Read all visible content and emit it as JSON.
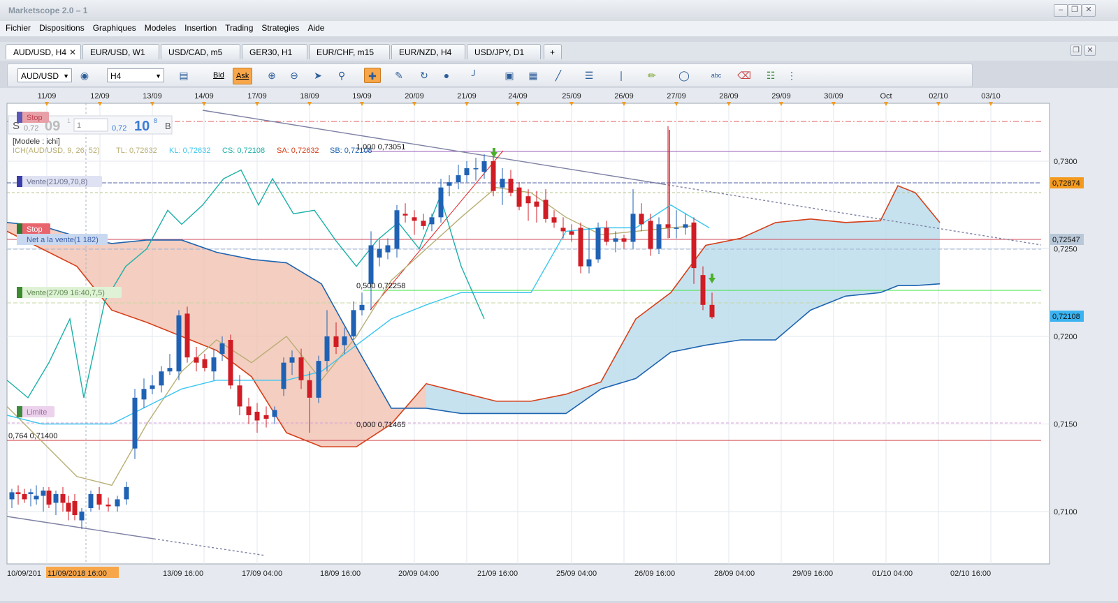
{
  "app": {
    "title": "Marketscope 2.0 – 1",
    "window_buttons": [
      "minimize-icon",
      "restore-icon",
      "close-icon"
    ]
  },
  "menu": [
    "Fichier",
    "Dispositions",
    "Graphiques",
    "Modeles",
    "Insertion",
    "Trading",
    "Strategies",
    "Aide"
  ],
  "tabs": [
    {
      "label": "AUD/USD, H4",
      "active": true,
      "closable": true
    },
    {
      "label": "EUR/USD, W1"
    },
    {
      "label": "USD/CAD, m5"
    },
    {
      "label": "GER30, H1"
    },
    {
      "label": "EUR/CHF, m15"
    },
    {
      "label": "EUR/NZD, H4"
    },
    {
      "label": "USD/JPY, D1"
    }
  ],
  "add_tab_label": "+",
  "toolbar": {
    "instrument": "AUD/USD",
    "timeframe": "H4",
    "bid_label": "Bid",
    "ask_label": "Ask",
    "icons": [
      "chart-type-icon",
      "price-icon",
      "zoom-in-icon",
      "zoom-out-icon",
      "cursor-icon",
      "zoom-fit-icon",
      "crosshair-icon",
      "chart-settings-icon",
      "sync-icon",
      "globe-icon",
      "ruler-icon",
      "image-icon",
      "template-icon",
      "line-tools-icon",
      "levels-icon",
      "fibonacci-icon",
      "pencil-icon",
      "shapes-icon",
      "text-icon",
      "eraser-icon",
      "tree-icon",
      "more-icon"
    ]
  },
  "chart": {
    "top_dates": [
      "11/09",
      "12/09",
      "13/09",
      "14/09",
      "17/09",
      "18/09",
      "19/09",
      "20/09",
      "21/09",
      "24/09",
      "25/09",
      "26/09",
      "27/09",
      "28/09",
      "29/09",
      "30/09",
      "Oct",
      "02/10",
      "03/10"
    ],
    "bottom_dates": [
      "10/09/201",
      "11/09/2018 16:00",
      "13/09 16:00",
      "17/09 04:00",
      "18/09 16:00",
      "20/09 04:00",
      "21/09 16:00",
      "25/09 04:00",
      "26/09 16:00",
      "28/09 04:00",
      "29/09 16:00",
      "01/10 04:00",
      "02/10 16:00"
    ],
    "price_axis": [
      "0,7300",
      "0,7250",
      "0,7200",
      "0,7150",
      "0,7100"
    ],
    "price_tags": [
      {
        "label": "0,72874",
        "color": "#f39a1e"
      },
      {
        "label": "0,72547",
        "color": "#b9c8d8"
      },
      {
        "label": "0,72108",
        "color": "#3ab3f0"
      }
    ],
    "quote": {
      "sell_label": "S",
      "sell_small": "0,72",
      "sell_big": "09",
      "sell_sup": "1",
      "spread": "1",
      "buy_small": "0,72",
      "buy_big": "10",
      "buy_sup": "8",
      "buy_label": "B"
    },
    "model_label": "[Modele : ichi]",
    "indicator": {
      "name": "ICH(AUD/USD, 9, 26, 52)",
      "tl": "TL: 0,72632",
      "kl": "KL: 0,72632",
      "cs": "CS: 0,72108",
      "sa": "SA: 0,72632",
      "sb": "SB: 0,72108"
    },
    "fib_labels": [
      "1,000 0,73051",
      "0,500 0,72258",
      "0,000 0,71465"
    ],
    "level_label": "0,764 0,71400",
    "orders": [
      "Stop",
      "Vente(21/09,70,8)",
      "Stop",
      "Net a la vente(1 182)",
      "Vente(27/09 16:40,7,5)",
      "Limite"
    ],
    "colors": {
      "bull": "#1f62b4",
      "bear": "#d01c24",
      "tenkan": "#b8ae74",
      "kijun": "#3bc6f0",
      "chikou": "#1bb0a8",
      "span_a": "#d5401a",
      "span_b": "#1e64b0",
      "cloud_bear": "#f0c2b2",
      "cloud_bull": "#b9dbeb"
    }
  }
}
